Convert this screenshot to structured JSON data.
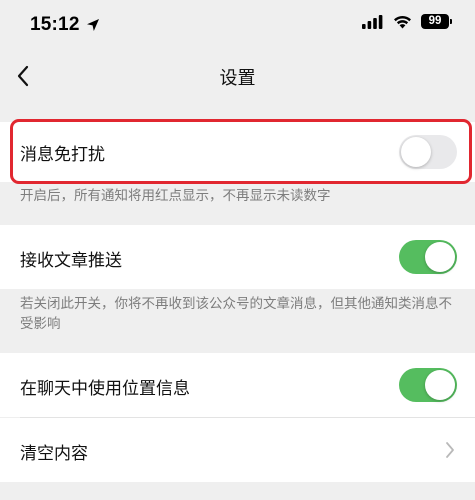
{
  "status_bar": {
    "time": "15:12",
    "battery": "99",
    "icons": [
      "location-arrow-icon",
      "cellular-signal-icon",
      "wifi-icon",
      "battery-icon"
    ]
  },
  "nav": {
    "title": "设置",
    "back_icon": "chevron-left-icon"
  },
  "settings": {
    "dnd": {
      "label": "消息免打扰",
      "enabled": false,
      "description": "开启后，所有通知将用红点显示，不再显示未读数字",
      "highlighted": true
    },
    "receive_articles": {
      "label": "接收文章推送",
      "enabled": true,
      "description": "若关闭此开关，你将不再收到该公众号的文章消息，但其他通知类消息不受影响"
    },
    "use_location": {
      "label": "在聊天中使用位置信息",
      "enabled": true
    },
    "clear_content": {
      "label": "清空内容",
      "icon": "chevron-right-icon"
    }
  },
  "colors": {
    "background": "#efefef",
    "toggle_on": "#55bd5f",
    "toggle_off": "#e9e9eb",
    "highlight": "#e12730",
    "description_text": "#7d7d7d"
  }
}
